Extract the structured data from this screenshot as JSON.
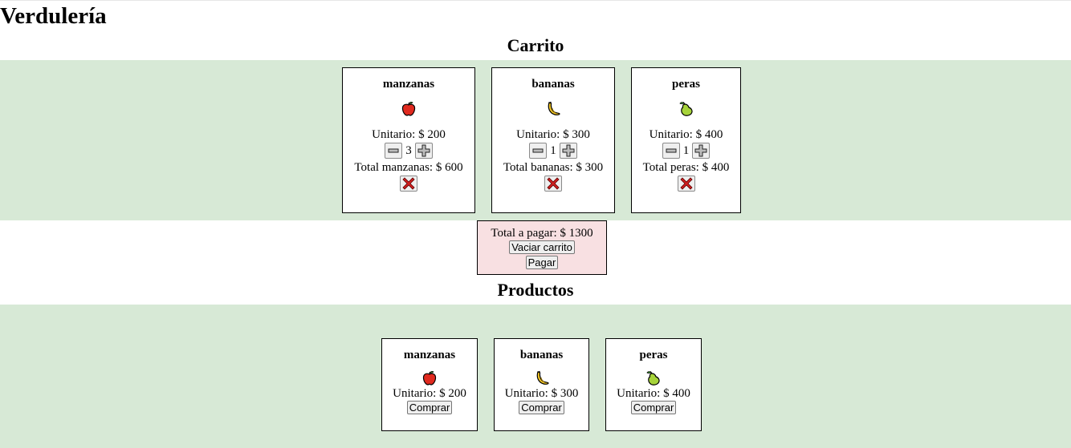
{
  "app": {
    "title": "Verdulería"
  },
  "cart": {
    "title": "Carrito",
    "items": [
      {
        "name": "manzanas",
        "icon": "apple-icon",
        "unit_label": "Unitario: $ 200",
        "quantity": "3",
        "total_label": "Total manzanas: $ 600"
      },
      {
        "name": "bananas",
        "icon": "banana-icon",
        "unit_label": "Unitario: $ 300",
        "quantity": "1",
        "total_label": "Total bananas: $ 300"
      },
      {
        "name": "peras",
        "icon": "pear-icon",
        "unit_label": "Unitario: $ 400",
        "quantity": "1",
        "total_label": "Total peras: $ 400"
      }
    ],
    "summary": {
      "total_label": "Total a pagar: $ 1300",
      "empty_button": "Vaciar carrito",
      "pay_button": "Pagar"
    }
  },
  "products": {
    "title": "Productos",
    "items": [
      {
        "name": "manzanas",
        "icon": "apple-icon",
        "unit_label": "Unitario: $ 200",
        "buy_button": "Comprar"
      },
      {
        "name": "bananas",
        "icon": "banana-icon",
        "unit_label": "Unitario: $ 300",
        "buy_button": "Comprar"
      },
      {
        "name": "peras",
        "icon": "pear-icon",
        "unit_label": "Unitario: $ 400",
        "buy_button": "Comprar"
      }
    ]
  },
  "colors": {
    "band": "#d7e9d6",
    "total_box": "#f8e0e2",
    "remove_icon": "#d11f1f"
  }
}
